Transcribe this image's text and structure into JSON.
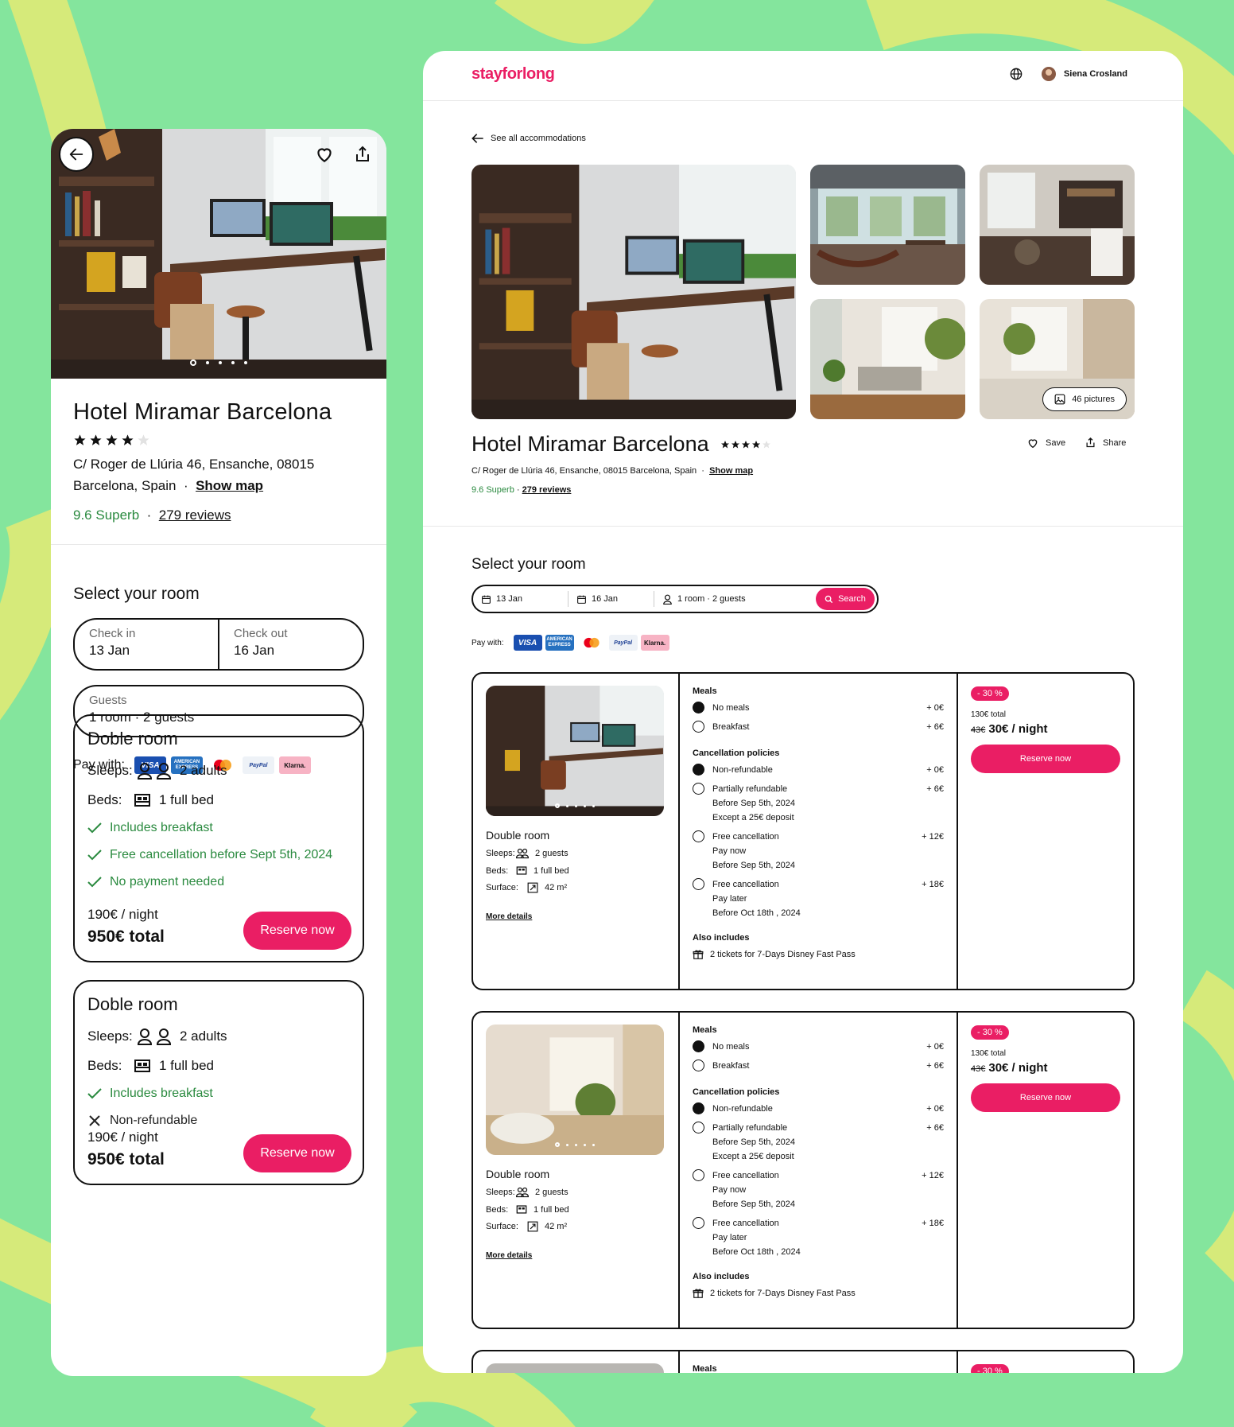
{
  "colors": {
    "brand": "#ea1e64",
    "background": "#84e59d",
    "swirl": "#d6ea7a",
    "success": "#2a8a3f"
  },
  "hotel": {
    "name": "Hotel Miramar Barcelona",
    "stars": 4,
    "address_line1": "C/ Roger de Llúria 46, Ensanche, 08015",
    "address_line2": "Barcelona, Spain",
    "address_full": "C/ Roger de Llúria 46, Ensanche, 08015 Barcelona, Spain",
    "show_map": "Show map",
    "rating": "9.6 Superb",
    "reviews": "279 reviews",
    "separator": "·"
  },
  "mobile": {
    "gallery": {
      "dots": 5,
      "active": 0,
      "back_icon": "arrow-left-icon",
      "heart_icon": "heart-icon",
      "share_icon": "share-icon"
    },
    "select_title": "Select your room",
    "check_in_label": "Check in",
    "check_in_value": "13 Jan",
    "check_out_label": "Check out",
    "check_out_value": "16 Jan",
    "guests_label": "Guests",
    "guests_value": "1 room · 2 guests",
    "pay_with": "Pay with:",
    "rooms": [
      {
        "title": "Doble room",
        "sleeps_label": "Sleeps:",
        "sleeps": "2 adults",
        "beds_label": "Beds:",
        "beds": "1 full bed",
        "features": [
          {
            "text": "Includes breakfast",
            "ok": true
          },
          {
            "text": "Free cancellation before Sept 5th, 2024",
            "ok": true
          },
          {
            "text": "No payment needed",
            "ok": true
          }
        ],
        "per_night": "190€ / night",
        "total": "950€ total",
        "cta": "Reserve now"
      },
      {
        "title": "Doble room",
        "sleeps_label": "Sleeps:",
        "sleeps": "2 adults",
        "beds_label": "Beds:",
        "beds": "1 full bed",
        "features": [
          {
            "text": "Includes breakfast",
            "ok": true
          },
          {
            "text": "Non-refundable",
            "ok": false
          }
        ],
        "per_night": "190€ / night",
        "total": "950€ total",
        "cta": "Reserve now"
      }
    ]
  },
  "desktop": {
    "logo": "stayforlong",
    "user_name": "Siena Crosland",
    "globe_icon": "globe-icon",
    "back_link": "See all accommodations",
    "pictures_label": "46 pictures",
    "save": "Save",
    "share": "Share",
    "select_title": "Select your room",
    "search": {
      "check_in": "13 Jan",
      "check_out": "16 Jan",
      "guests": "1 room · 2 guests",
      "button": "Search"
    },
    "pay_with": "Pay with:",
    "payment_methods": [
      "VISA",
      "AMERICAN EXPRESS",
      "Mastercard",
      "PayPal",
      "Klarna."
    ],
    "rooms": [
      {
        "title": "Double room",
        "sleeps_label": "Sleeps:",
        "sleeps": "2 guests",
        "beds_label": "Beds:",
        "beds": "1 full bed",
        "surface_label": "Surface:",
        "surface": "42 m²",
        "more": "More details",
        "meals_title": "Meals",
        "meals": [
          {
            "t": "No meals",
            "p": "+ 0€",
            "on": true
          },
          {
            "t": "Breakfast",
            "p": "+ 6€",
            "on": false
          }
        ],
        "cancel_title": "Cancellation policies",
        "cancel": [
          {
            "t": "Non-refundable",
            "sub": [],
            "p": "+ 0€",
            "on": true
          },
          {
            "t": "Partially refundable",
            "sub": [
              "Before Sep 5th, 2024",
              "Except a 25€ deposit"
            ],
            "p": "+ 6€",
            "on": false
          },
          {
            "t": "Free cancellation",
            "sub": [
              "Pay now",
              "Before Sep 5th, 2024"
            ],
            "p": "+ 12€",
            "on": false
          },
          {
            "t": "Free cancellation",
            "sub": [
              "Pay later",
              "Before Oct 18th , 2024"
            ],
            "p": "+ 18€",
            "on": false
          }
        ],
        "also_title": "Also includes",
        "also": "2 tickets for 7-Days Disney Fast Pass",
        "discount": "- 30 %",
        "total": "130€ total",
        "old_price": "43€",
        "price": "30€ / night",
        "cta": "Reserve now"
      },
      {
        "title": "Double room",
        "sleeps_label": "Sleeps:",
        "sleeps": "2 guests",
        "beds_label": "Beds:",
        "beds": "1 full bed",
        "surface_label": "Surface:",
        "surface": "42 m²",
        "more": "More details",
        "meals_title": "Meals",
        "meals": [
          {
            "t": "No meals",
            "p": "+ 0€",
            "on": true
          },
          {
            "t": "Breakfast",
            "p": "+ 6€",
            "on": false
          }
        ],
        "cancel_title": "Cancellation policies",
        "cancel": [
          {
            "t": "Non-refundable",
            "sub": [],
            "p": "+ 0€",
            "on": true
          },
          {
            "t": "Partially refundable",
            "sub": [
              "Before Sep 5th, 2024",
              "Except a 25€ deposit"
            ],
            "p": "+ 6€",
            "on": false
          },
          {
            "t": "Free cancellation",
            "sub": [
              "Pay now",
              "Before Sep 5th, 2024"
            ],
            "p": "+ 12€",
            "on": false
          },
          {
            "t": "Free cancellation",
            "sub": [
              "Pay later",
              "Before Oct 18th , 2024"
            ],
            "p": "+ 18€",
            "on": false
          }
        ],
        "also_title": "Also includes",
        "also": "2 tickets for 7-Days Disney Fast Pass",
        "discount": "- 30 %",
        "total": "130€ total",
        "old_price": "43€",
        "price": "30€ / night",
        "cta": "Reserve now"
      }
    ],
    "third_room_meals": "Meals"
  }
}
